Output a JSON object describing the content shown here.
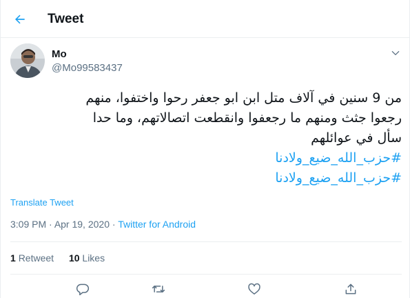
{
  "header": {
    "title": "Tweet",
    "back_icon": "arrow-left-icon"
  },
  "author": {
    "name": "Mo",
    "handle": "@Mo99583437",
    "avatar_icon": "user-avatar"
  },
  "tweet": {
    "lines": [
      "من 9 سنين في آلاف متل ابن ابو جعفر رحوا واختفوا، منهم",
      "رجعوا جثث ومنهم ما رجعفوا وانقطعت اتصالاتهم، وما حدا",
      "سأل في عوائلهم"
    ],
    "hashtags": [
      "#حزب_الله_ضيع_ولادنا",
      "#حزب_الله_ضيع_ولادنا"
    ]
  },
  "translate_label": "Translate Tweet",
  "meta": {
    "time": "3:09 PM",
    "separator1": " · ",
    "date": "Apr 19, 2020",
    "separator2": " · ",
    "source": "Twitter for Android"
  },
  "stats": {
    "retweets_count": "1",
    "retweets_label": "Retweet",
    "likes_count": "10",
    "likes_label": "Likes"
  },
  "actions": {
    "reply_icon": "reply-icon",
    "retweet_icon": "retweet-icon",
    "like_icon": "heart-icon",
    "share_icon": "share-icon"
  },
  "colors": {
    "accent": "#1da1f2",
    "text": "#0f1419",
    "secondary": "#5b7083",
    "border": "#ebeef0"
  }
}
